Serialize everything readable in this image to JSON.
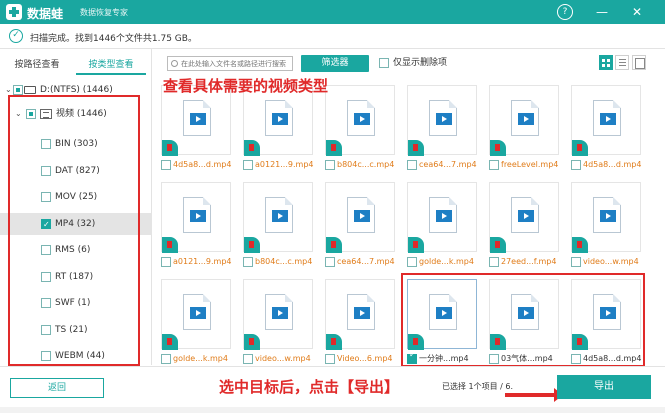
{
  "titlebar": {
    "brand": "数据蛙",
    "subtitle": "数据恢复专家",
    "help": "?",
    "minimize": "—",
    "close": "✕"
  },
  "status": {
    "icon": "check-circle-icon",
    "text": "扫描完成。找到1446个文件共1.75 GB。"
  },
  "left": {
    "tabs": [
      "按路径查看",
      "按类型查看"
    ],
    "active_tab": 1,
    "drive": "D:(NTFS) (1446)",
    "video": "视频 (1446)",
    "types": [
      {
        "label": "BIN (303)",
        "checked": false
      },
      {
        "label": "DAT (827)",
        "checked": false
      },
      {
        "label": "MOV (25)",
        "checked": false
      },
      {
        "label": "MP4 (32)",
        "checked": true,
        "selected": true
      },
      {
        "label": "RMS (6)",
        "checked": false
      },
      {
        "label": "RT (187)",
        "checked": false
      },
      {
        "label": "SWF (1)",
        "checked": false
      },
      {
        "label": "TS (21)",
        "checked": false
      },
      {
        "label": "WEBM (44)",
        "checked": false
      }
    ]
  },
  "toolbar": {
    "search_placeholder": "在此处输入文件名或路径进行搜索",
    "filter_label": "筛选器",
    "only_deleted_label": "仅显示删除项"
  },
  "annotations": {
    "top": "查看具体需要的视频类型",
    "bottom": "选中目标后，点击【导出】"
  },
  "files": [
    {
      "name": "4d5a8...d.mp4",
      "checked": false
    },
    {
      "name": "a0121...9.mp4",
      "checked": false
    },
    {
      "name": "b804c...c.mp4",
      "checked": false
    },
    {
      "name": "cea64...7.mp4",
      "checked": false
    },
    {
      "name": "freeLevel.mp4",
      "checked": false
    },
    {
      "name": "4d5a8...d.mp4",
      "checked": false
    },
    {
      "name": "a0121...9.mp4",
      "checked": false
    },
    {
      "name": "b804c...c.mp4",
      "checked": false
    },
    {
      "name": "cea64...7.mp4",
      "checked": false
    },
    {
      "name": "golde...k.mp4",
      "checked": false
    },
    {
      "name": "27eed...f.mp4",
      "checked": false
    },
    {
      "name": "video...w.mp4",
      "checked": false
    },
    {
      "name": "golde...k.mp4",
      "checked": false
    },
    {
      "name": "video...w.mp4",
      "checked": false
    },
    {
      "name": "Video...6.mp4",
      "checked": false
    },
    {
      "name": "一分钟...mp4",
      "checked": true
    },
    {
      "name": "03气体...mp4",
      "checked": false
    },
    {
      "name": "4d5a8...d.mp4",
      "checked": false
    }
  ],
  "bottom": {
    "back_label": "返回",
    "selection_info": "已选择 1个项目 / 6.",
    "export_label": "导出"
  }
}
